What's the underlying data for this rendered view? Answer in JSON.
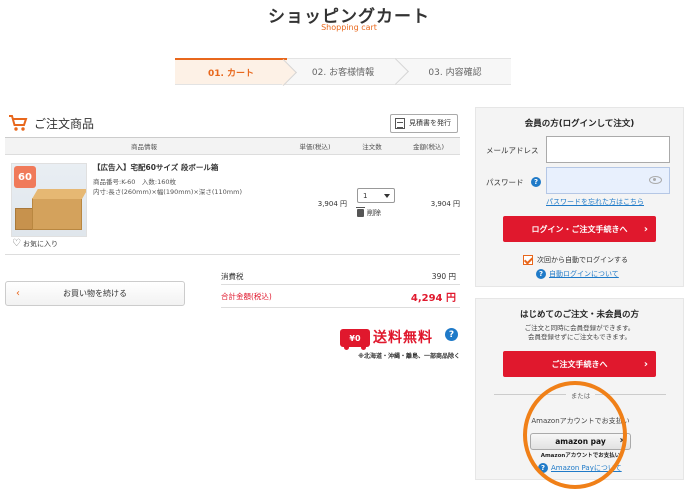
{
  "header": {
    "title": "ショッピングカート",
    "subtitle": "Shopping cart"
  },
  "steps": [
    {
      "label": "01. カート",
      "active": true
    },
    {
      "label": "02. お客様情報",
      "active": false
    },
    {
      "label": "03. 内容確認",
      "active": false
    }
  ],
  "cart": {
    "title": "ご注文商品",
    "quote_button": "見積書を発行",
    "columns": {
      "product": "商品情報",
      "unit_price": "単価(税込)",
      "qty": "注文数",
      "amount": "金額(税込)"
    },
    "item": {
      "badge": "60",
      "name": "【広告入】宅配60サイズ 段ボール箱",
      "meta_line1": "商品番号:K-60　入数:160枚",
      "meta_line2": "内寸:長さ(260mm)×幅(190mm)×深さ(110mm)",
      "unit_price": "3,904 円",
      "qty": "1",
      "delete_label": "削除",
      "amount": "3,904 円",
      "favorite_label": "お気に入り"
    },
    "continue_button": "お買い物を続ける",
    "tax_label": "消費税",
    "tax_value": "390 円",
    "total_label": "合計金額(税込)",
    "total_value": "4,294 円",
    "shipping_badge": "¥0",
    "shipping_text": "送料無料",
    "shipping_help": "?",
    "shipping_note": "※北海道・沖縄・離島、一部商品除く"
  },
  "login": {
    "title": "会員の方(ログインして注文)",
    "email_label": "メールアドレス",
    "email_value": "",
    "password_label": "パスワード",
    "password_value": "",
    "forgot_link": "パスワードを忘れた方はこちら",
    "login_button": "ログイン・ご注文手続きへ",
    "auto_login_label": "次回から自動でログインする",
    "auto_login_checked": true,
    "auto_login_about": "自動ログインについて"
  },
  "guest": {
    "title": "はじめてのご注文・未会員の方",
    "desc_line1": "ご注文と同時に会員登録ができます。",
    "desc_line2": "会員登録せずにご注文もできます。",
    "order_button": "ご注文手続きへ",
    "or_text": "または",
    "amazon_caption": "Amazonアカウントでお支払い",
    "amazon_button": "amazon pay",
    "amazon_sub": "Amazonアカウントでお支払い",
    "amazon_about": "Amazon Payについて"
  },
  "colors": {
    "accent": "#e8671c",
    "primary_button": "#e0182d",
    "link": "#1f7ac8"
  }
}
